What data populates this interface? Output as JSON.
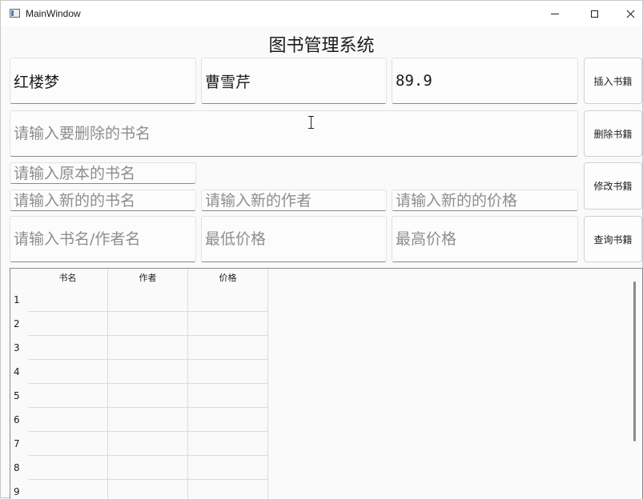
{
  "window": {
    "title": "MainWindow"
  },
  "header": {
    "title": "图书管理系统"
  },
  "insert": {
    "book_value": "红楼梦",
    "author_value": "曹雪芹",
    "price_value": "89.9",
    "button_label": "插入书籍"
  },
  "delete": {
    "placeholder": "请输入要删除的书名",
    "button_label": "删除书籍"
  },
  "modify": {
    "old_name_placeholder": "请输入原本的书名",
    "new_name_placeholder": "请输入新的的书名",
    "new_author_placeholder": "请输入新的作者",
    "new_price_placeholder": "请输入新的的价格",
    "button_label": "修改书籍"
  },
  "query": {
    "keyword_placeholder": "请输入书名/作者名",
    "min_price_placeholder": "最低价格",
    "max_price_placeholder": "最高价格",
    "button_label": "查询书籍"
  },
  "table": {
    "columns": [
      "书名",
      "作者",
      "价格"
    ],
    "rows": [
      "1",
      "2",
      "3",
      "4",
      "5",
      "6",
      "7",
      "8",
      "9"
    ]
  }
}
